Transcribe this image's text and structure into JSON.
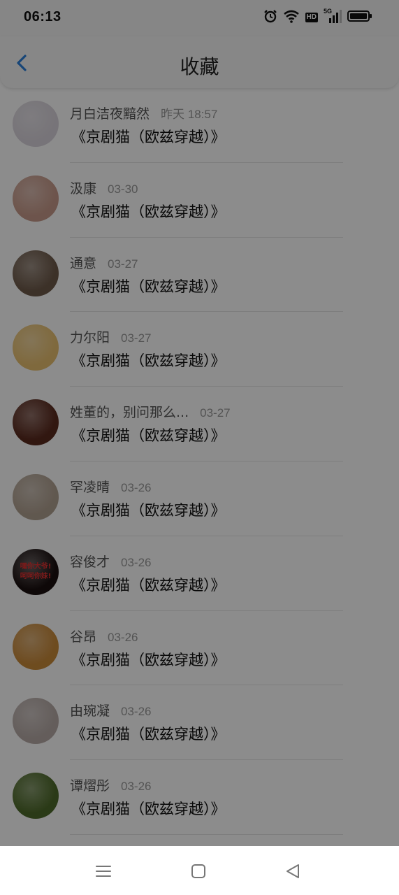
{
  "status_bar": {
    "time": "06:13",
    "hd": "HD",
    "network": "5G"
  },
  "header": {
    "title": "收藏"
  },
  "items": [
    {
      "name": "月白洁夜黯然",
      "date": "昨天 18:57",
      "text": "《京剧猫（欧兹穿越）》",
      "avatar_color": "#d9d4dc"
    },
    {
      "name": "汲康",
      "date": "03-30",
      "text": "《京剧猫（欧兹穿越）》",
      "avatar_color": "#c79a8a"
    },
    {
      "name": "通意",
      "date": "03-27",
      "text": "《京剧猫（欧兹穿越）》",
      "avatar_color": "#6e5a4a"
    },
    {
      "name": "力尔阳",
      "date": "03-27",
      "text": "《京剧猫（欧兹穿越）》",
      "avatar_color": "#e8c070"
    },
    {
      "name": "姓董的，别问那么...",
      "date": "03-27",
      "text": "《京剧猫（欧兹穿越）》",
      "avatar_color": "#5a2a1e"
    },
    {
      "name": "罕凌晴",
      "date": "03-26",
      "text": "《京剧猫（欧兹穿越）》",
      "avatar_color": "#b0a090"
    },
    {
      "name": "容俊才",
      "date": "03-26",
      "text": "《京剧猫（欧兹穿越）》",
      "avatar_color": "#1a1010",
      "avatar_text": [
        "嘿你大爷!",
        "呵呵你妹!"
      ]
    },
    {
      "name": "谷昂",
      "date": "03-26",
      "text": "《京剧猫（欧兹穿越）》",
      "avatar_color": "#c98a3a"
    },
    {
      "name": "由琬凝",
      "date": "03-26",
      "text": "《京剧猫（欧兹穿越）》",
      "avatar_color": "#b6aaa6"
    },
    {
      "name": "谭熠彤",
      "date": "03-26",
      "text": "《京剧猫（欧兹穿越）》",
      "avatar_color": "#4e6a2a"
    }
  ],
  "colors": {
    "accent": "#2b7fd9",
    "dim_overlay": "rgba(0,0,0,0.45)"
  },
  "nav": {
    "icons": [
      "menu-icon",
      "home-square-icon",
      "back-triangle-icon"
    ]
  }
}
